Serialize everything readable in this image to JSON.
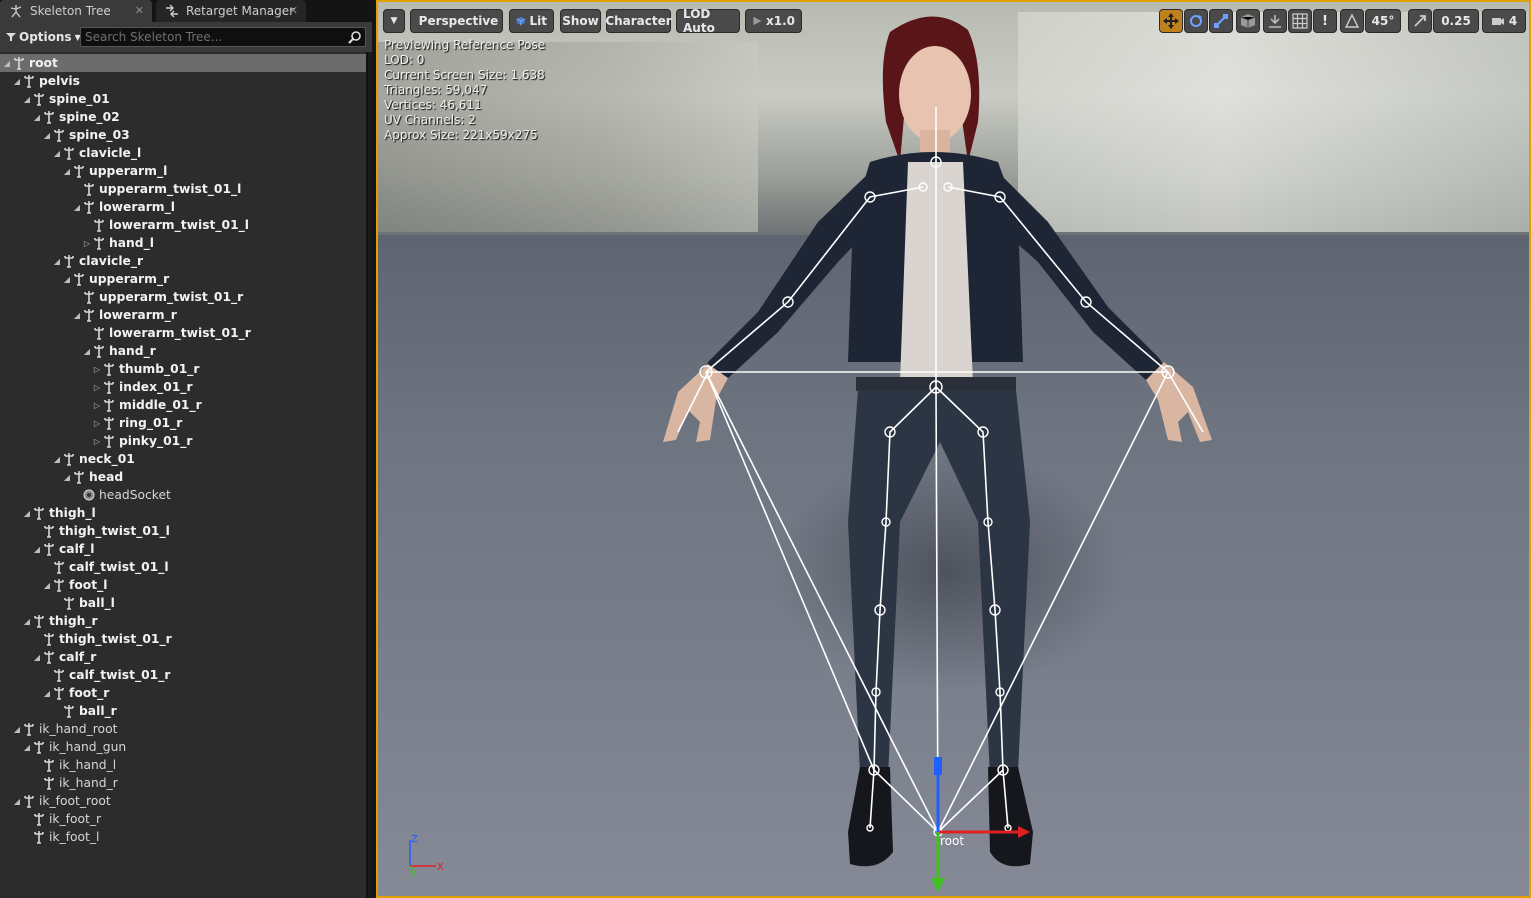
{
  "tabs": [
    {
      "label": "Skeleton Tree",
      "active": true,
      "icon": "skeleton-icon"
    },
    {
      "label": "Retarget Manager",
      "active": false,
      "icon": "retarget-icon"
    }
  ],
  "tree_toolbar": {
    "options_label": "Options",
    "search_placeholder": "Search Skeleton Tree..."
  },
  "tree": [
    {
      "label": "root",
      "depth": 0,
      "expander": "expanded",
      "icon": "bone",
      "style": "selected"
    },
    {
      "label": "pelvis",
      "depth": 1,
      "expander": "expanded",
      "icon": "bone",
      "style": "bold"
    },
    {
      "label": "spine_01",
      "depth": 2,
      "expander": "expanded",
      "icon": "bone",
      "style": "bold"
    },
    {
      "label": "spine_02",
      "depth": 3,
      "expander": "expanded",
      "icon": "bone",
      "style": "bold"
    },
    {
      "label": "spine_03",
      "depth": 4,
      "expander": "expanded",
      "icon": "bone",
      "style": "bold"
    },
    {
      "label": "clavicle_l",
      "depth": 5,
      "expander": "expanded",
      "icon": "bone",
      "style": "bold"
    },
    {
      "label": "upperarm_l",
      "depth": 6,
      "expander": "expanded",
      "icon": "bone",
      "style": "bold"
    },
    {
      "label": "upperarm_twist_01_l",
      "depth": 7,
      "expander": "none",
      "icon": "bone",
      "style": "bold"
    },
    {
      "label": "lowerarm_l",
      "depth": 7,
      "expander": "expanded",
      "icon": "bone",
      "style": "bold"
    },
    {
      "label": "lowerarm_twist_01_l",
      "depth": 8,
      "expander": "none",
      "icon": "bone",
      "style": "bold"
    },
    {
      "label": "hand_l",
      "depth": 8,
      "expander": "collapsed",
      "icon": "bone",
      "style": "bold"
    },
    {
      "label": "clavicle_r",
      "depth": 5,
      "expander": "expanded",
      "icon": "bone",
      "style": "bold"
    },
    {
      "label": "upperarm_r",
      "depth": 6,
      "expander": "expanded",
      "icon": "bone",
      "style": "bold"
    },
    {
      "label": "upperarm_twist_01_r",
      "depth": 7,
      "expander": "none",
      "icon": "bone",
      "style": "bold"
    },
    {
      "label": "lowerarm_r",
      "depth": 7,
      "expander": "expanded",
      "icon": "bone",
      "style": "bold"
    },
    {
      "label": "lowerarm_twist_01_r",
      "depth": 8,
      "expander": "none",
      "icon": "bone",
      "style": "bold"
    },
    {
      "label": "hand_r",
      "depth": 8,
      "expander": "expanded",
      "icon": "bone",
      "style": "bold"
    },
    {
      "label": "thumb_01_r",
      "depth": 9,
      "expander": "collapsed",
      "icon": "bone",
      "style": "bold"
    },
    {
      "label": "index_01_r",
      "depth": 9,
      "expander": "collapsed",
      "icon": "bone",
      "style": "bold"
    },
    {
      "label": "middle_01_r",
      "depth": 9,
      "expander": "collapsed",
      "icon": "bone",
      "style": "bold"
    },
    {
      "label": "ring_01_r",
      "depth": 9,
      "expander": "collapsed",
      "icon": "bone",
      "style": "bold"
    },
    {
      "label": "pinky_01_r",
      "depth": 9,
      "expander": "collapsed",
      "icon": "bone",
      "style": "bold"
    },
    {
      "label": "neck_01",
      "depth": 5,
      "expander": "expanded",
      "icon": "bone",
      "style": "bold"
    },
    {
      "label": "head",
      "depth": 6,
      "expander": "expanded",
      "icon": "bone",
      "style": "bold"
    },
    {
      "label": "headSocket",
      "depth": 7,
      "expander": "none",
      "icon": "socket",
      "style": "dim"
    },
    {
      "label": "thigh_l",
      "depth": 2,
      "expander": "expanded",
      "icon": "bone",
      "style": "bold"
    },
    {
      "label": "thigh_twist_01_l",
      "depth": 3,
      "expander": "none",
      "icon": "bone",
      "style": "bold"
    },
    {
      "label": "calf_l",
      "depth": 3,
      "expander": "expanded",
      "icon": "bone",
      "style": "bold"
    },
    {
      "label": "calf_twist_01_l",
      "depth": 4,
      "expander": "none",
      "icon": "bone",
      "style": "bold"
    },
    {
      "label": "foot_l",
      "depth": 4,
      "expander": "expanded",
      "icon": "bone",
      "style": "bold"
    },
    {
      "label": "ball_l",
      "depth": 5,
      "expander": "none",
      "icon": "bone",
      "style": "bold"
    },
    {
      "label": "thigh_r",
      "depth": 2,
      "expander": "expanded",
      "icon": "bone",
      "style": "bold"
    },
    {
      "label": "thigh_twist_01_r",
      "depth": 3,
      "expander": "none",
      "icon": "bone",
      "style": "bold"
    },
    {
      "label": "calf_r",
      "depth": 3,
      "expander": "expanded",
      "icon": "bone",
      "style": "bold"
    },
    {
      "label": "calf_twist_01_r",
      "depth": 4,
      "expander": "none",
      "icon": "bone",
      "style": "bold"
    },
    {
      "label": "foot_r",
      "depth": 4,
      "expander": "expanded",
      "icon": "bone",
      "style": "bold"
    },
    {
      "label": "ball_r",
      "depth": 5,
      "expander": "none",
      "icon": "bone",
      "style": "bold"
    },
    {
      "label": "ik_hand_root",
      "depth": 1,
      "expander": "expanded",
      "icon": "bone",
      "style": "dim"
    },
    {
      "label": "ik_hand_gun",
      "depth": 2,
      "expander": "expanded",
      "icon": "bone",
      "style": "dim"
    },
    {
      "label": "ik_hand_l",
      "depth": 3,
      "expander": "none",
      "icon": "bone",
      "style": "dim"
    },
    {
      "label": "ik_hand_r",
      "depth": 3,
      "expander": "none",
      "icon": "bone",
      "style": "dim"
    },
    {
      "label": "ik_foot_root",
      "depth": 1,
      "expander": "expanded",
      "icon": "bone",
      "style": "dim"
    },
    {
      "label": "ik_foot_r",
      "depth": 2,
      "expander": "none",
      "icon": "bone",
      "style": "dim"
    },
    {
      "label": "ik_foot_l",
      "depth": 2,
      "expander": "none",
      "icon": "bone",
      "style": "dim"
    }
  ],
  "viewport": {
    "toolbar": {
      "perspective": "Perspective",
      "lit": "Lit",
      "show": "Show",
      "character": "Character",
      "lod": "LOD Auto",
      "playrate": "x1.0",
      "angle_snap": "45°",
      "scale_snap": "0.25",
      "camera_speed": "4"
    },
    "stats": [
      "Previewing Reference Pose",
      "LOD: 0",
      "Current Screen Size: 1.638",
      "Triangles: 59,047",
      "Vertices: 46,611",
      "UV Channels: 2",
      "Approx Size: 221x59x275"
    ],
    "selected_bone_label": "root",
    "axis_labels": {
      "z": "Z",
      "y": "Y",
      "x": "X"
    },
    "colors": {
      "accent": "#e0a000",
      "selection": "#6c6c6c",
      "axis_x": "#e02020",
      "axis_y": "#40c020",
      "axis_z": "#2060ff"
    }
  }
}
